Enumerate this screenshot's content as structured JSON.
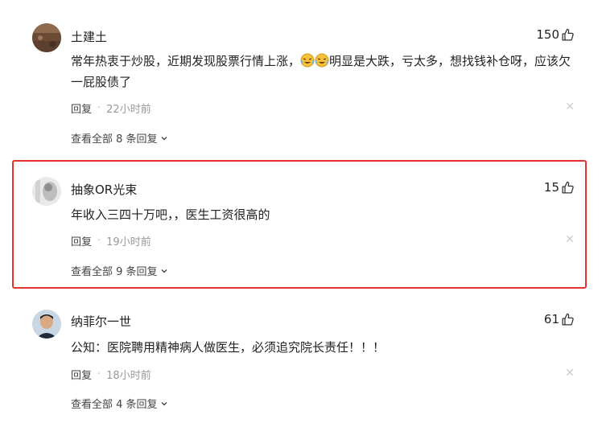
{
  "comments": [
    {
      "author": "土建土",
      "likes": "150",
      "content_before": "常年热衷于炒股，近期发现股票行情上涨，",
      "content_after": "明显是大跌，亏太多，想找钱补仓呀，应该欠一屁股债了",
      "emoji_icon": "crying-laughing-emoji-icon",
      "reply_label": "回复",
      "time": "22小时前",
      "view_all": "查看全部 8 条回复"
    },
    {
      "author": "抽象OR光束",
      "likes": "15",
      "content": "年收入三四十万吧，，医生工资很高的",
      "reply_label": "回复",
      "time": "19小时前",
      "view_all": "查看全部 9 条回复",
      "highlighted": true,
      "highlight_color": "#e5322d"
    },
    {
      "author": "纳菲尔一世",
      "likes": "61",
      "content": "公知：医院聘用精神病人做医生，必须追究院长责任！！！",
      "reply_label": "回复",
      "time": "18小时前",
      "view_all": "查看全部 4 条回复"
    }
  ],
  "icons": {
    "like": "thumbs-up-icon",
    "close": "close-icon",
    "expand": "chevron-down-icon"
  }
}
